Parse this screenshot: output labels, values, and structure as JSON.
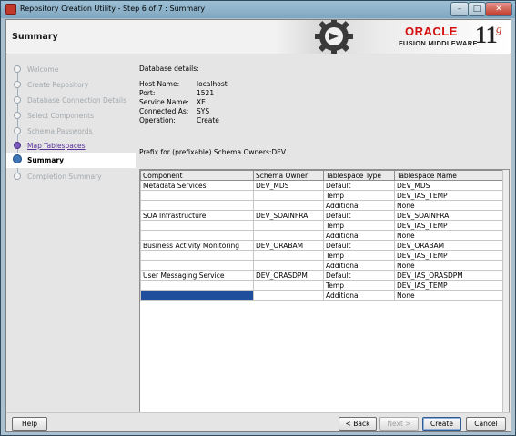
{
  "window": {
    "title": "Repository Creation Utility - Step 6 of 7 : Summary",
    "controls": {
      "minimize": "–",
      "maximize": "□",
      "close": "✕"
    }
  },
  "header": {
    "title": "Summary",
    "brand_oracle": "ORACLE",
    "brand_fusion": "FUSION MIDDLEWARE",
    "brand_version": "11",
    "brand_version_suffix": "g"
  },
  "nav": {
    "items": [
      {
        "label": "Welcome",
        "state": "done"
      },
      {
        "label": "Create Repository",
        "state": "done"
      },
      {
        "label": "Database Connection Details",
        "state": "done"
      },
      {
        "label": "Select Components",
        "state": "done"
      },
      {
        "label": "Schema Passwords",
        "state": "done"
      },
      {
        "label": "Map Tablespaces",
        "state": "link"
      },
      {
        "label": "Summary",
        "state": "current"
      },
      {
        "label": "Completion Summary",
        "state": "pending"
      }
    ]
  },
  "content": {
    "db_heading": "Database details:",
    "details": [
      {
        "key": "Host Name:",
        "value": "localhost"
      },
      {
        "key": "Port:",
        "value": "1521"
      },
      {
        "key": "Service Name:",
        "value": "XE"
      },
      {
        "key": "Connected As:",
        "value": "SYS"
      },
      {
        "key": "Operation:",
        "value": "Create"
      }
    ],
    "prefix_text": "Prefix for (prefixable) Schema Owners:DEV",
    "table": {
      "headers": [
        "Component",
        "Schema Owner",
        "Tablespace Type",
        "Tablespace Name"
      ],
      "rows": [
        [
          "Metadata Services",
          "DEV_MDS",
          "Default",
          "DEV_MDS"
        ],
        [
          "",
          "",
          "Temp",
          "DEV_IAS_TEMP"
        ],
        [
          "",
          "",
          "Additional",
          "None"
        ],
        [
          "SOA Infrastructure",
          "DEV_SOAINFRA",
          "Default",
          "DEV_SOAINFRA"
        ],
        [
          "",
          "",
          "Temp",
          "DEV_IAS_TEMP"
        ],
        [
          "",
          "",
          "Additional",
          "None"
        ],
        [
          "Business Activity Monitoring",
          "DEV_ORABAM",
          "Default",
          "DEV_ORABAM"
        ],
        [
          "",
          "",
          "Temp",
          "DEV_IAS_TEMP"
        ],
        [
          "",
          "",
          "Additional",
          "None"
        ],
        [
          "User Messaging Service",
          "DEV_ORASDPM",
          "Default",
          "DEV_IAS_ORASDPM"
        ],
        [
          "",
          "",
          "Temp",
          "DEV_IAS_TEMP"
        ],
        [
          "",
          "",
          "Additional",
          "None"
        ]
      ]
    }
  },
  "footer": {
    "help": "Help",
    "back": "< Back",
    "next": "Next >",
    "create": "Create",
    "cancel": "Cancel"
  }
}
